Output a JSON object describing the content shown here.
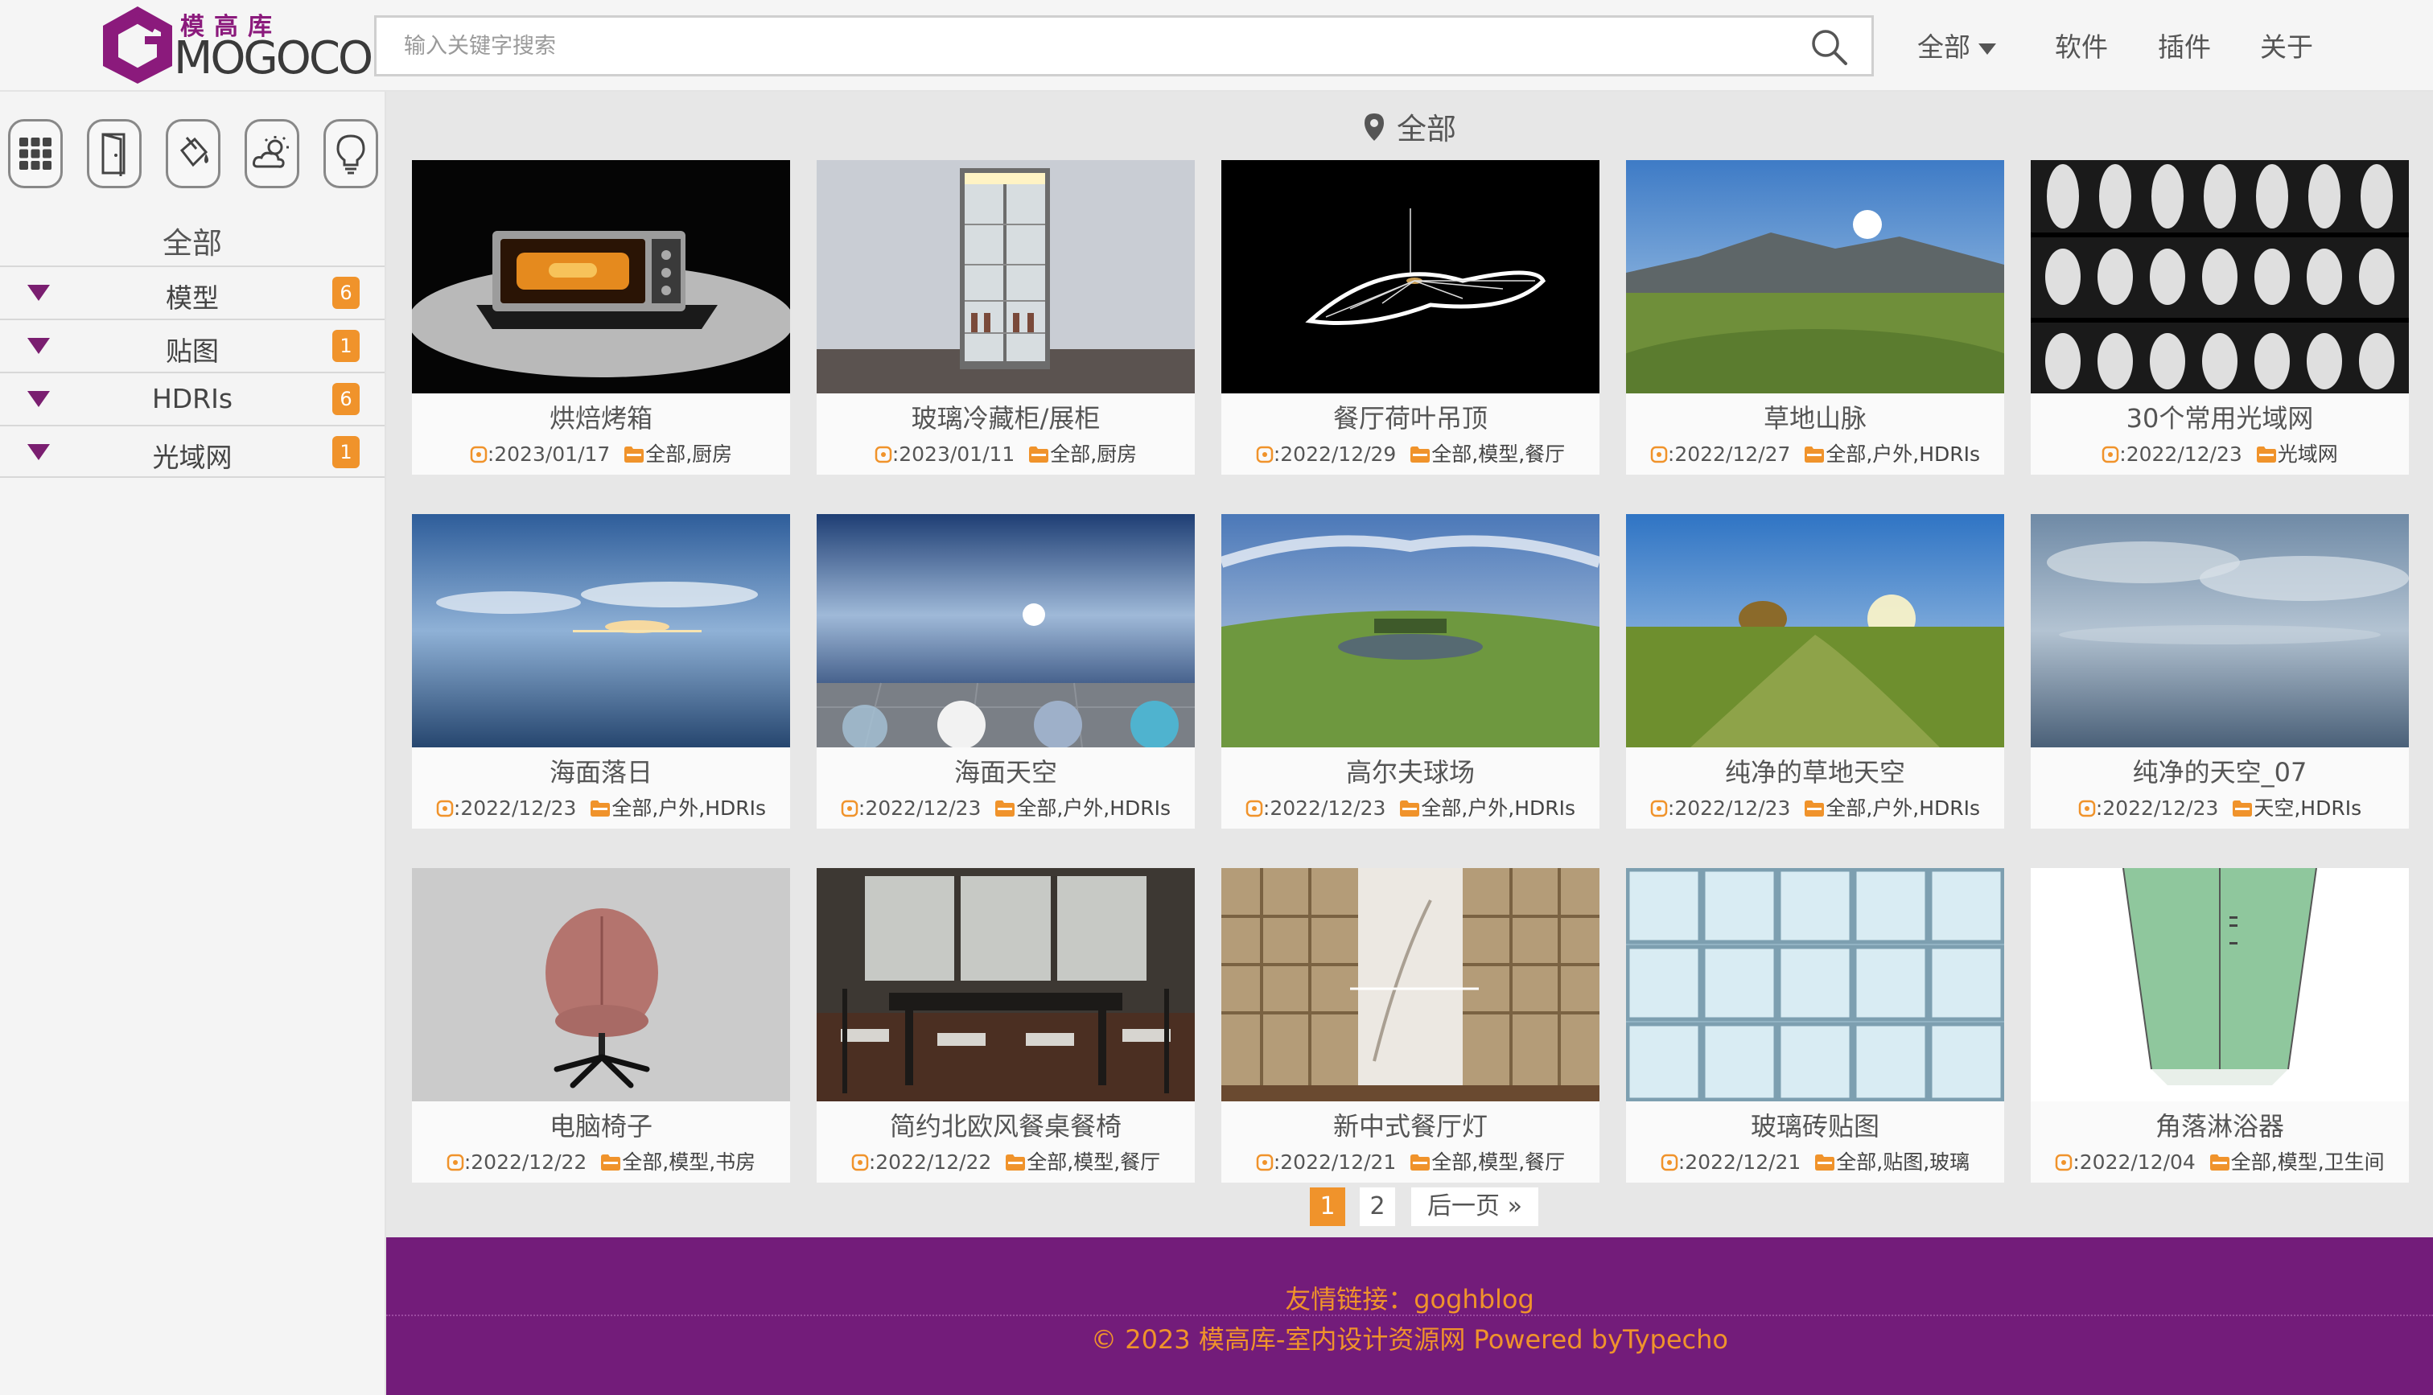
{
  "header": {
    "logo_cn": "模高库",
    "logo_en": "MOGOCO",
    "search_placeholder": "输入关键字搜索",
    "nav": [
      {
        "label": "全部",
        "dropdown": true
      },
      {
        "label": "软件"
      },
      {
        "label": "插件"
      },
      {
        "label": "关于"
      }
    ]
  },
  "sidebar": {
    "category_icons": [
      "grid-icon",
      "door-icon",
      "paint-bucket-icon",
      "sun-cloud-icon",
      "lightbulb-icon"
    ],
    "title": "全部",
    "items": [
      {
        "label": "模型",
        "count": "6"
      },
      {
        "label": "贴图",
        "count": "1"
      },
      {
        "label": "HDRIs",
        "count": "6"
      },
      {
        "label": "光域网",
        "count": "1"
      }
    ]
  },
  "main": {
    "breadcrumb": "全部",
    "cards": [
      {
        "title": "烘焙烤箱",
        "date": ":2023/01/17",
        "tags": "全部,厨房",
        "thumb": "oven"
      },
      {
        "title": "玻璃冷藏柜/展柜",
        "date": ":2023/01/11",
        "tags": "全部,厨房",
        "thumb": "fridge"
      },
      {
        "title": "餐厅荷叶吊顶",
        "date": ":2022/12/29",
        "tags": "全部,模型,餐厅",
        "thumb": "pendant"
      },
      {
        "title": "草地山脉",
        "date": ":2022/12/27",
        "tags": "全部,户外,HDRIs",
        "thumb": "mountain"
      },
      {
        "title": "30个常用光域网",
        "date": ":2022/12/23",
        "tags": "光域网",
        "thumb": "ies"
      },
      {
        "title": "海面落日",
        "date": ":2022/12/23",
        "tags": "全部,户外,HDRIs",
        "thumb": "sunset"
      },
      {
        "title": "海面天空",
        "date": ":2022/12/23",
        "tags": "全部,户外,HDRIs",
        "thumb": "seasky"
      },
      {
        "title": "高尔夫球场",
        "date": ":2022/12/23",
        "tags": "全部,户外,HDRIs",
        "thumb": "golf"
      },
      {
        "title": "纯净的草地天空",
        "date": ":2022/12/23",
        "tags": "全部,户外,HDRIs",
        "thumb": "grassland"
      },
      {
        "title": "纯净的天空_07",
        "date": ":2022/12/23",
        "tags": "天空,HDRIs",
        "thumb": "cloudsky"
      },
      {
        "title": "电脑椅子",
        "date": ":2022/12/22",
        "tags": "全部,模型,书房",
        "thumb": "chair"
      },
      {
        "title": "简约北欧风餐桌餐椅",
        "date": ":2022/12/22",
        "tags": "全部,模型,餐厅",
        "thumb": "dining"
      },
      {
        "title": "新中式餐厅灯",
        "date": ":2022/12/21",
        "tags": "全部,模型,餐厅",
        "thumb": "winewall"
      },
      {
        "title": "玻璃砖贴图",
        "date": ":2022/12/21",
        "tags": "全部,贴图,玻璃",
        "thumb": "glassbrick"
      },
      {
        "title": "角落淋浴器",
        "date": ":2022/12/04",
        "tags": "全部,模型,卫生间",
        "thumb": "shower"
      }
    ]
  },
  "pagination": {
    "pages": [
      "1",
      "2"
    ],
    "current": "1",
    "next_label": "后一页 »"
  },
  "footer": {
    "links_text": "友情链接：goghblog",
    "copyright": "© 2023 模高库-室内设计资源网   Powered byTypecho"
  },
  "colors": {
    "brand_purple": "#731c7a",
    "accent_orange": "#f0932b"
  }
}
